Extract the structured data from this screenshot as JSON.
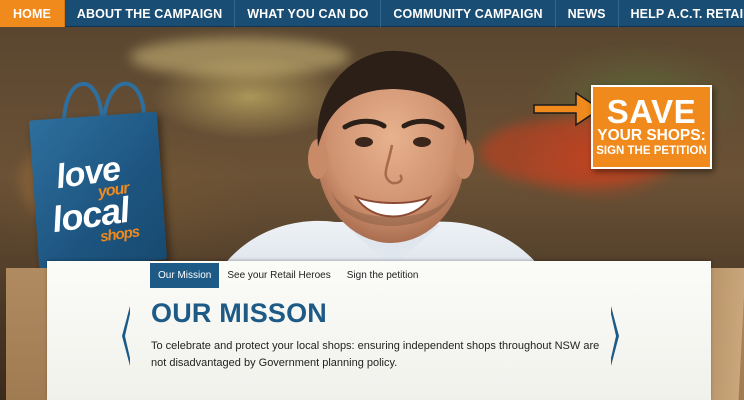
{
  "nav": {
    "items": [
      {
        "label": "HOME",
        "active": true
      },
      {
        "label": "ABOUT THE CAMPAIGN",
        "active": false
      },
      {
        "label": "WHAT YOU CAN DO",
        "active": false
      },
      {
        "label": "COMMUNITY CAMPAIGN",
        "active": false
      },
      {
        "label": "NEWS",
        "active": false
      },
      {
        "label": "HELP A.C.T. RETAILERS",
        "active": false
      }
    ]
  },
  "logo": {
    "line1": "love",
    "line2": "your",
    "line3": "local",
    "line4": "shops"
  },
  "petition": {
    "line1": "SAVE",
    "line2": "YOUR SHOPS:",
    "line3": "SIGN THE PETITION"
  },
  "content": {
    "tabs": [
      {
        "label": "Our Mission",
        "active": true
      },
      {
        "label": "See your Retail Heroes",
        "active": false
      },
      {
        "label": "Sign the petition",
        "active": false
      }
    ],
    "title": "OUR MISSON",
    "body": "To celebrate and protect your local shops: ensuring independent shops throughout NSW are not disadvantaged by Government planning policy."
  },
  "colors": {
    "nav_bg": "#1a4d73",
    "accent": "#f08a1c",
    "brand_blue": "#1d5a86"
  }
}
